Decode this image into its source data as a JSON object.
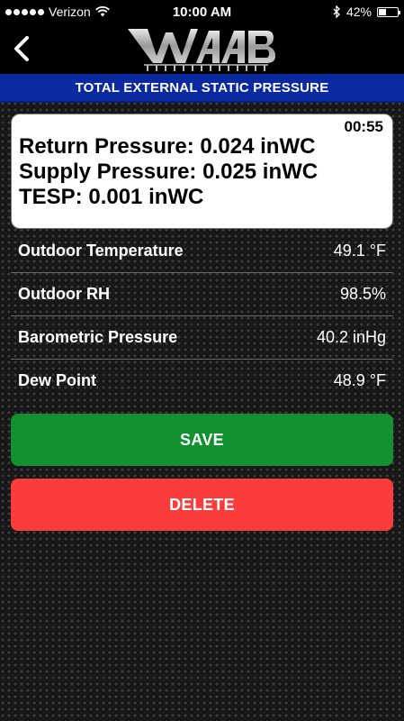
{
  "status_bar": {
    "carrier": "Verizon",
    "time": "10:00 AM",
    "battery": "42%",
    "battery_level": 0.42
  },
  "header": {
    "logo_text": "WAAB",
    "back_icon": "chevron-left-icon"
  },
  "title": "TOTAL EXTERNAL STATIC PRESSURE",
  "readings": {
    "timer": "00:55",
    "return_pressure": "Return Pressure: 0.024 inWC",
    "supply_pressure": "Supply Pressure: 0.025 inWC",
    "tesp": "TESP: 0.001 inWC"
  },
  "conditions": [
    {
      "label": "Outdoor Temperature",
      "value": "49.1 °F"
    },
    {
      "label": "Outdoor RH",
      "value": "98.5%"
    },
    {
      "label": "Barometric Pressure",
      "value": "40.2 inHg"
    },
    {
      "label": "Dew Point",
      "value": "48.9 °F"
    }
  ],
  "actions": {
    "save_label": "SAVE",
    "delete_label": "DELETE",
    "save_color": "#12922f",
    "delete_color": "#fa3c3c"
  }
}
